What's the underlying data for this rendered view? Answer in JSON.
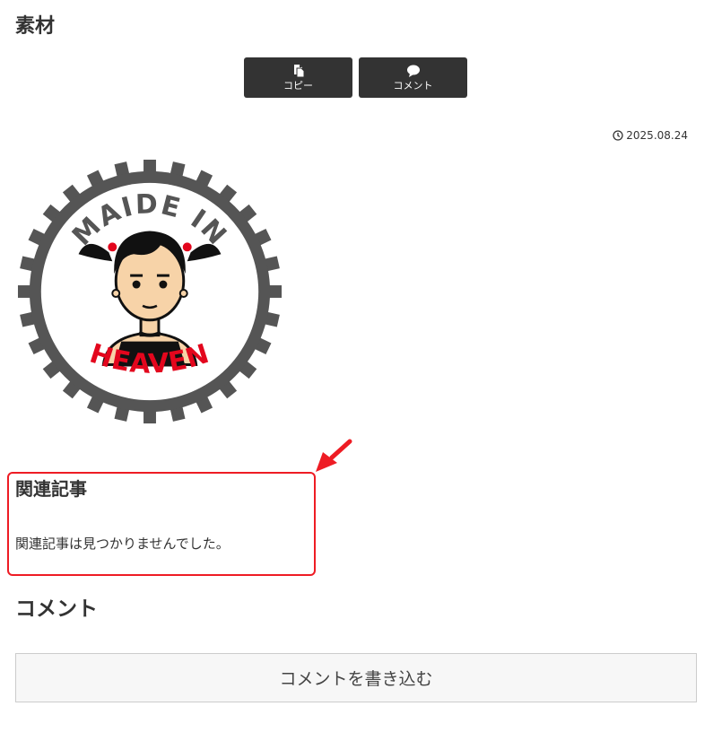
{
  "header": {
    "title": "素材"
  },
  "share": {
    "copy": {
      "label": "コピー",
      "icon": "copy-icon"
    },
    "comment": {
      "label": "コメント",
      "icon": "speech-bubble-icon"
    }
  },
  "post": {
    "date": "2025.08.24",
    "date_icon": "clock-icon",
    "image": {
      "top_text": "MAIDE IN",
      "bottom_text": "HEAVEN",
      "gear_color": "#555555",
      "accent_color": "#e3061d"
    }
  },
  "related": {
    "title": "関連記事",
    "empty_message": "関連記事は見つかりませんでした。",
    "highlight_color": "#ee1c24"
  },
  "comments": {
    "title": "コメント",
    "write_button": "コメントを書き込む"
  }
}
